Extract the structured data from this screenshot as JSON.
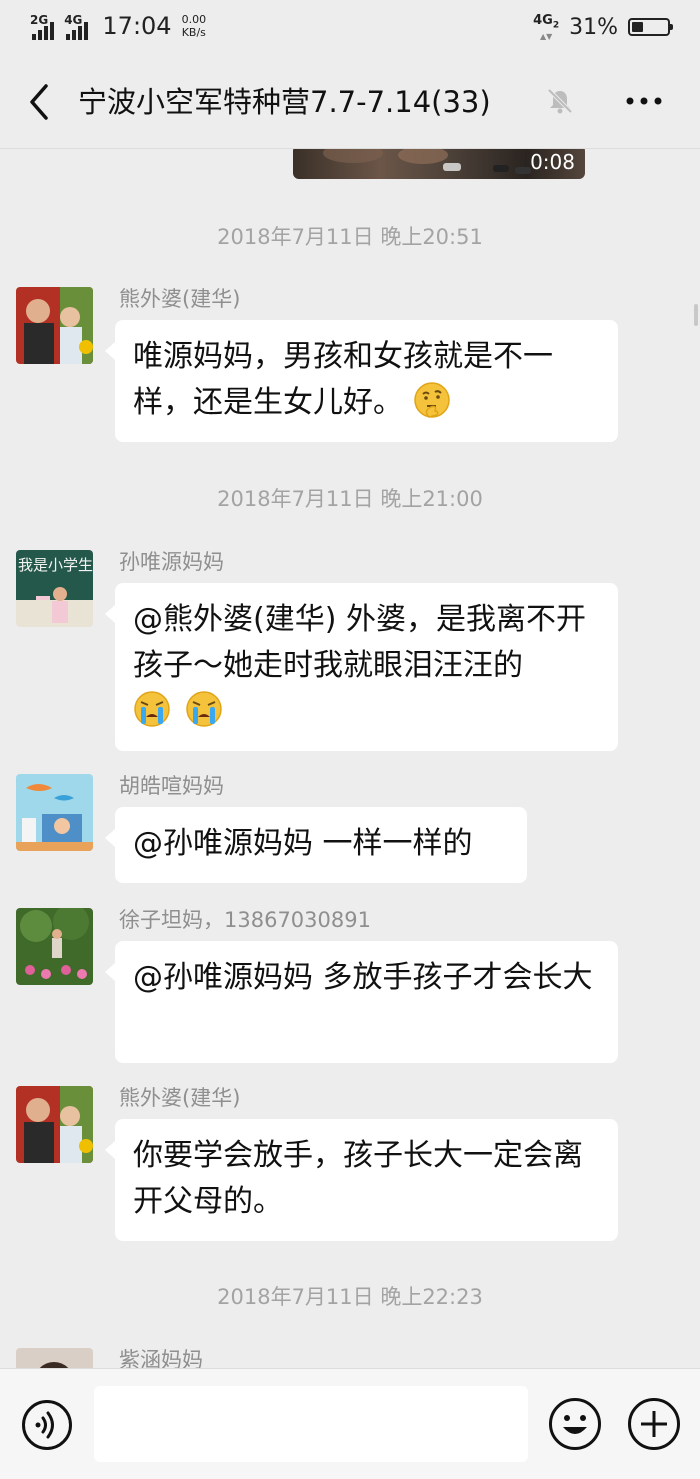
{
  "status_bar": {
    "net1": "2G",
    "net2": "4G",
    "time": "17:04",
    "speed_value": "0.00",
    "speed_unit": "KB/s",
    "net_right": "4G",
    "net_right_sub": "2",
    "battery_percent": "31%",
    "battery_level": 0.31
  },
  "header": {
    "title": "宁波小空军特种营7.7-7.14(33)",
    "back_icon": "chevron-left-icon",
    "mute_icon": "bell-muted-icon",
    "more_icon": "more-dots-icon"
  },
  "chat": {
    "video": {
      "duration": "0:08"
    },
    "timestamps": [
      "2018年7月11日 晚上20:51",
      "2018年7月11日 晚上21:00",
      "2018年7月11日 晚上22:23"
    ],
    "messages": [
      {
        "sender": "熊外婆(建华)",
        "text": "唯源妈妈，男孩和女孩就是不一样，还是生女儿好。",
        "emoji": "thinking-face-emoji"
      },
      {
        "sender": "孙唯源妈妈",
        "text": "@熊外婆(建华)  外婆，是我离不开孩子～她走时我就眼泪汪汪的",
        "emoji": "crying-face-emoji"
      },
      {
        "sender": "胡皓喧妈妈",
        "text": "@孙唯源妈妈  一样一样的"
      },
      {
        "sender": "徐子坦妈，13867030891",
        "text": "@孙唯源妈妈  多放手孩子才会长大"
      },
      {
        "sender": "熊外婆(建华)",
        "text": "你要学会放手，孩子长大一定会离开父母的。"
      },
      {
        "sender": "紫涵妈妈",
        "text": ""
      }
    ]
  },
  "input_bar": {
    "voice_icon": "voice-icon",
    "emoji_icon": "emoji-smile-icon",
    "plus_icon": "plus-circle-icon"
  },
  "colors": {
    "background": "#ededed",
    "bubble": "#ffffff",
    "timestamp": "#a3a3a3",
    "sender": "#8f8f8f",
    "text": "#111111"
  }
}
